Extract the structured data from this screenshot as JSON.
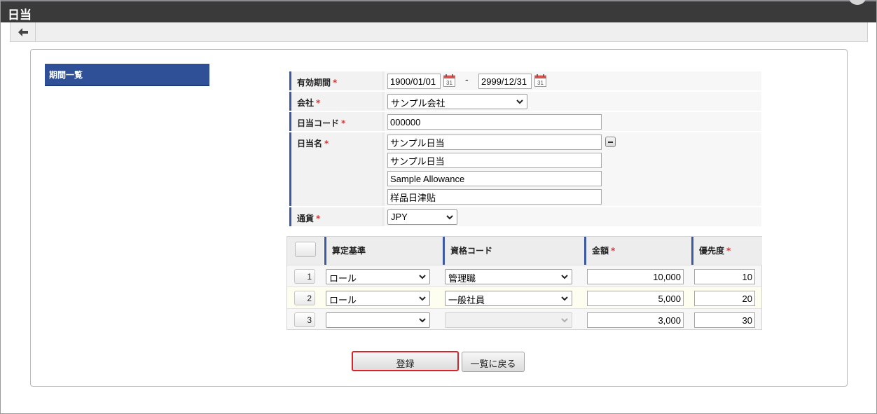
{
  "window": {
    "title": "日当"
  },
  "toolbar": {
    "back_icon": "back-arrow-icon"
  },
  "sidebar": {
    "items": [
      {
        "label": "期間一覧"
      }
    ]
  },
  "form": {
    "required_mark": "*",
    "period": {
      "label": "有効期間",
      "start": "1900/01/01",
      "separator": "-",
      "end": "2999/12/31",
      "calendar_day": "31"
    },
    "company": {
      "label": "会社",
      "value": "サンプル会社"
    },
    "code": {
      "label": "日当コード",
      "value": "000000"
    },
    "name": {
      "label": "日当名",
      "values": [
        "サンプル日当",
        "サンプル日当",
        "Sample Allowance",
        "样品日津贴"
      ]
    },
    "currency": {
      "label": "通貨",
      "value": "JPY"
    }
  },
  "grid": {
    "headers": {
      "basis": "算定基準",
      "qualification": "資格コード",
      "amount": "金額",
      "priority": "優先度"
    },
    "rows": [
      {
        "no": "1",
        "basis": "ロール",
        "qualification": "管理職",
        "amount": "10,000",
        "priority": "10"
      },
      {
        "no": "2",
        "basis": "ロール",
        "qualification": "一般社員",
        "amount": "5,000",
        "priority": "20"
      },
      {
        "no": "3",
        "basis": "",
        "qualification": "",
        "amount": "3,000",
        "priority": "30"
      }
    ]
  },
  "actions": {
    "register": "登録",
    "back_to_list": "一覧に戻る"
  },
  "colors": {
    "title_bar": "#3a3a3a",
    "accent_blue": "#2f4f96",
    "required": "#d23a3a",
    "primary_outline": "#d9222a"
  }
}
